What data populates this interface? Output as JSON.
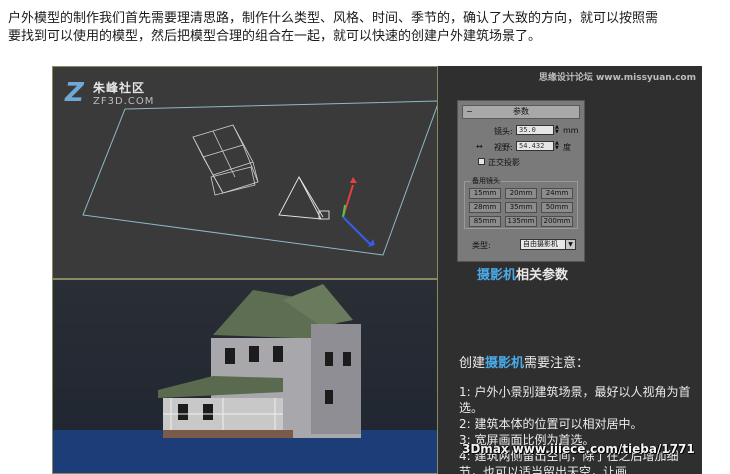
{
  "intro": {
    "line1": "户外模型的制作我们首先需要理清思路，制作什么类型、风格、时间、季节的，确认了大致的方向，就可以按照需",
    "line2": "要找到可以使用的模型，然后把模型合理的组合在一起，就可以快速的创建户外建筑场景了。"
  },
  "logo": {
    "name_cn": "朱峰社区",
    "domain": "ZF3D.COM",
    "mark": "Z"
  },
  "watermark_top": "思缘设计论坛 www.missyuan.com",
  "panel": {
    "title": "参数",
    "lens_label": "镜头:",
    "lens_value": "35.0",
    "lens_unit": "mm",
    "fov_label": "视野:",
    "fov_value": "54.432",
    "fov_unit": "度",
    "ortho_label": "正交投影",
    "stock_title": "备用镜头",
    "stock_lenses": [
      "15mm",
      "20mm",
      "24mm",
      "28mm",
      "35mm",
      "50mm",
      "85mm",
      "135mm",
      "200mm"
    ],
    "type_label": "类型:",
    "type_value": "自由摄影机"
  },
  "caption": {
    "highlight": "摄影机",
    "rest": "相关参数"
  },
  "notes": {
    "head_pre": "创建",
    "head_hl": "摄影机",
    "head_post": "需要注意：",
    "items": [
      "1: 户外小景别建筑场景，最好以人视角为首选。",
      "2: 建筑本体的位置可以相对居中。",
      "3: 宽屏画面比例为首选。",
      "4: 建筑两侧留出空间，除了在之后增加细节，也可以适当留出天空，让画"
    ]
  },
  "watermark_bottom": {
    "brand": "3Dmax",
    "url": "www.iiiece.com/tieba/1771"
  },
  "colors": {
    "accent": "#4aa9e8",
    "viewport_border": "#8a8a62",
    "panel_bg": "#7a7a7a"
  }
}
